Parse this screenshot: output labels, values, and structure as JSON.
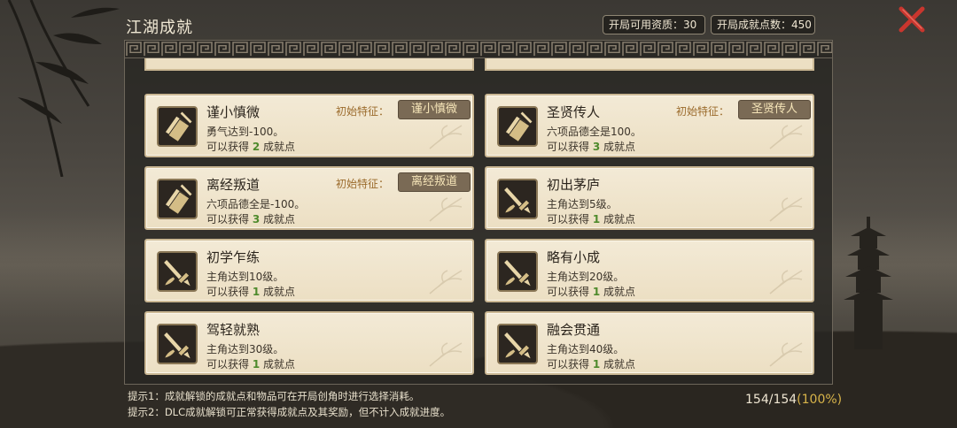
{
  "header": {
    "title": "江湖成就",
    "stat_talent_label": "开局可用资质：",
    "stat_talent_value": "30",
    "stat_points_label": "开局成就点数：",
    "stat_points_value": "450"
  },
  "achievements": [
    {
      "name": "谨小慎微",
      "desc": "勇气达到-100。",
      "reward_prefix": "可以获得",
      "points": "2",
      "reward_suffix": "成就点",
      "trait_label": "初始特征：",
      "trait": "谨小慎微",
      "icon": "scroll-icon"
    },
    {
      "name": "圣贤传人",
      "desc": "六项品德全是100。",
      "reward_prefix": "可以获得",
      "points": "3",
      "reward_suffix": "成就点",
      "trait_label": "初始特征：",
      "trait": "圣贤传人",
      "icon": "scroll-icon"
    },
    {
      "name": "离经叛道",
      "desc": "六项品德全是-100。",
      "reward_prefix": "可以获得",
      "points": "3",
      "reward_suffix": "成就点",
      "trait_label": "初始特征：",
      "trait": "离经叛道",
      "icon": "scroll-icon"
    },
    {
      "name": "初出茅庐",
      "desc": "主角达到5级。",
      "reward_prefix": "可以获得",
      "points": "1",
      "reward_suffix": "成就点",
      "icon": "sword-icon"
    },
    {
      "name": "初学乍练",
      "desc": "主角达到10级。",
      "reward_prefix": "可以获得",
      "points": "1",
      "reward_suffix": "成就点",
      "icon": "sword-icon"
    },
    {
      "name": "略有小成",
      "desc": "主角达到20级。",
      "reward_prefix": "可以获得",
      "points": "1",
      "reward_suffix": "成就点",
      "icon": "sword-icon"
    },
    {
      "name": "驾轻就熟",
      "desc": "主角达到30级。",
      "reward_prefix": "可以获得",
      "points": "1",
      "reward_suffix": "成就点",
      "icon": "sword-icon"
    },
    {
      "name": "融会贯通",
      "desc": "主角达到40级。",
      "reward_prefix": "可以获得",
      "points": "1",
      "reward_suffix": "成就点",
      "icon": "sword-icon"
    }
  ],
  "footer": {
    "hint1": "提示1：成就解锁的成就点和物品可在开局创角时进行选择消耗。",
    "hint2": "提示2：DLC成就解锁可正常获得成就点及其奖励，但不计入成就进度。",
    "progress_count": "154/154",
    "progress_pct": "(100%)"
  },
  "colors": {
    "card_bg": "#ecdfc3",
    "points_green": "#4e8a2c",
    "trait_tag": "#7a6a55",
    "close_red": "#c8362e"
  }
}
